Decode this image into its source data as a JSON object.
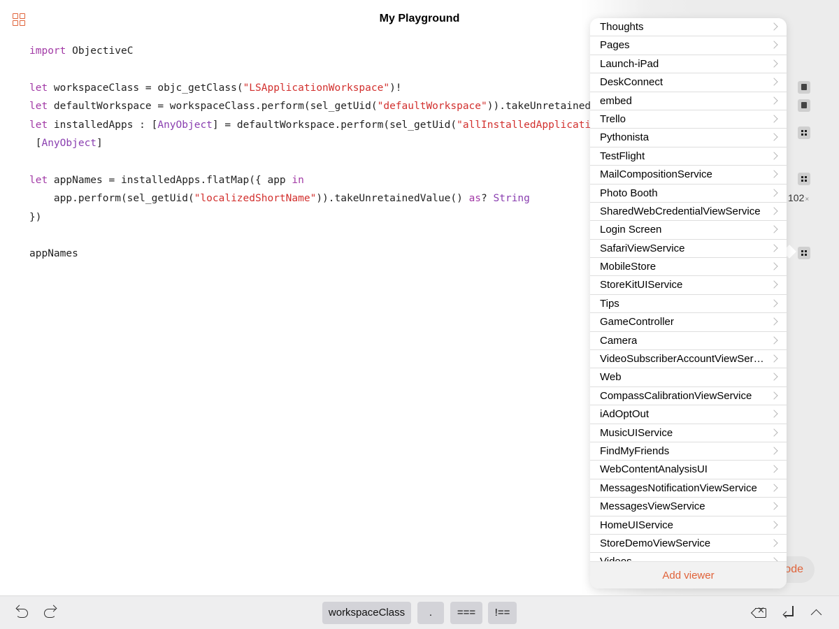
{
  "header": {
    "title": "My Playground",
    "left_icon": "grid-icon",
    "right_icons": [
      "tools-icon",
      "more-icon"
    ],
    "accent_color": "#e0633a"
  },
  "code": {
    "lines": [
      [
        {
          "t": "import",
          "c": "kw"
        },
        {
          "t": " ObjectiveC",
          "c": ""
        }
      ],
      [],
      [
        {
          "t": "let",
          "c": "kw"
        },
        {
          "t": " workspaceClass = objc_getClass(",
          "c": ""
        },
        {
          "t": "\"LSApplicationWorkspace\"",
          "c": "str"
        },
        {
          "t": ")!",
          "c": ""
        }
      ],
      [
        {
          "t": "let",
          "c": "kw"
        },
        {
          "t": " defaultWorkspace = workspaceClass.perform(sel_getUid(",
          "c": ""
        },
        {
          "t": "\"defaultWorkspace\"",
          "c": "str"
        },
        {
          "t": ")).takeUnretainedV",
          "c": ""
        }
      ],
      [
        {
          "t": "let",
          "c": "kw"
        },
        {
          "t": " installedApps : [",
          "c": ""
        },
        {
          "t": "AnyObject",
          "c": "ty"
        },
        {
          "t": "] = defaultWorkspace.perform(sel_getUid(",
          "c": ""
        },
        {
          "t": "\"allInstalledApplicatio",
          "c": "str"
        }
      ],
      [
        {
          "t": " [",
          "c": ""
        },
        {
          "t": "AnyObject",
          "c": "ty"
        },
        {
          "t": "]",
          "c": ""
        }
      ],
      [],
      [
        {
          "t": "let",
          "c": "kw"
        },
        {
          "t": " appNames = installedApps.flatMap({ app ",
          "c": ""
        },
        {
          "t": "in",
          "c": "kw"
        }
      ],
      [
        {
          "t": "    app.perform(sel_getUid(",
          "c": ""
        },
        {
          "t": "\"localizedShortName\"",
          "c": "str"
        },
        {
          "t": ")).takeUnretainedValue() ",
          "c": ""
        },
        {
          "t": "as",
          "c": "kw"
        },
        {
          "t": "? ",
          "c": ""
        },
        {
          "t": "String",
          "c": "ty"
        }
      ],
      [
        {
          "t": "})",
          "c": ""
        }
      ],
      [],
      [
        {
          "t": "appNames",
          "c": ""
        }
      ]
    ]
  },
  "results": {
    "count": "102",
    "count_suffix": "×",
    "marker_icons": [
      "cube-icon",
      "cube-icon",
      "grid-result-icon",
      "grid-result-icon",
      "grid-result-icon"
    ]
  },
  "viewer_list": {
    "items": [
      "Thoughts",
      "Pages",
      "Launch-iPad",
      "DeskConnect",
      "embed",
      "Trello",
      "Pythonista",
      "TestFlight",
      "MailCompositionService",
      "Photo Booth",
      "SharedWebCredentialViewService",
      "Login Screen",
      "SafariViewService",
      "MobileStore",
      "StoreKitUIService",
      "Tips",
      "GameController",
      "Camera",
      "VideoSubscriberAccountViewService",
      "Web",
      "CompassCalibrationViewService",
      "iAdOptOut",
      "MusicUIService",
      "FindMyFriends",
      "WebContentAnalysisUI",
      "MessagesNotificationViewService",
      "MessagesViewService",
      "HomeUIService",
      "StoreDemoViewService",
      "Videos"
    ],
    "add_viewer_label": "Add viewer"
  },
  "open_code_partial": "ode",
  "keyboard_bar": {
    "keys": [
      "workspaceClass",
      ".",
      "===",
      "!=="
    ],
    "icons": [
      "undo-icon",
      "redo-icon",
      "delete-icon",
      "return-icon",
      "chevron-up-icon"
    ]
  }
}
